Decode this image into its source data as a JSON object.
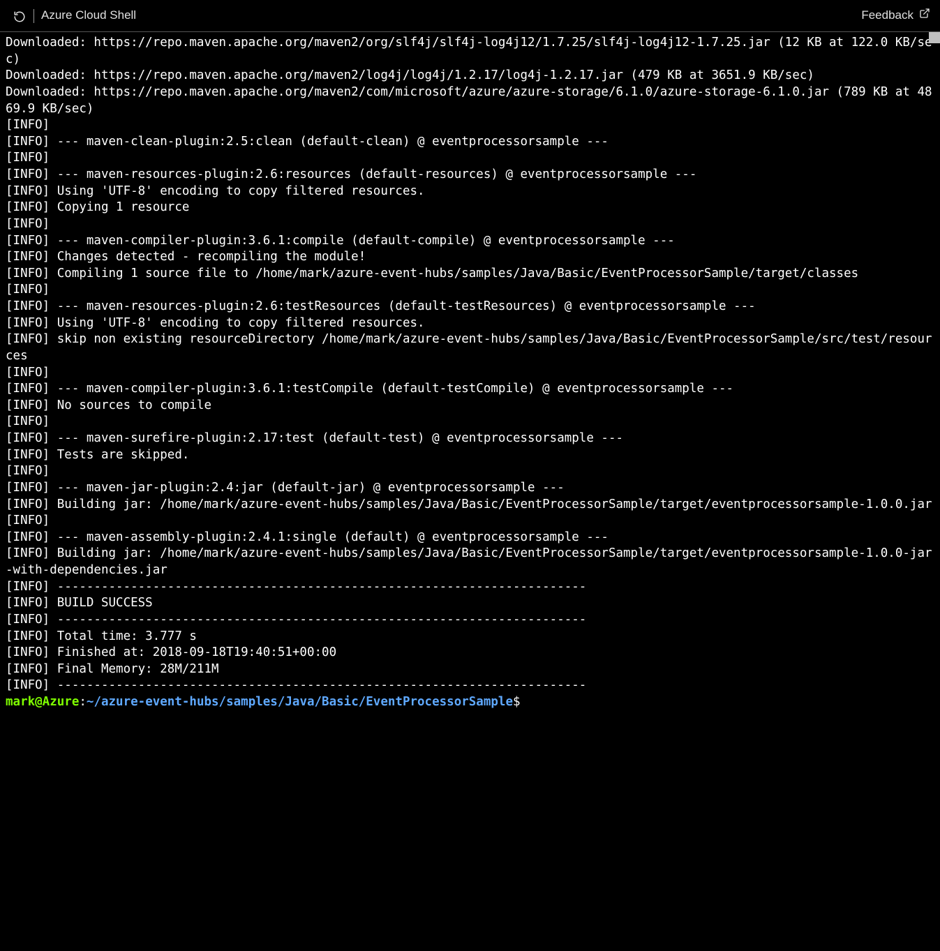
{
  "header": {
    "title": "Azure Cloud Shell",
    "feedback_label": "Feedback"
  },
  "terminal_output": "Downloaded: https://repo.maven.apache.org/maven2/org/slf4j/slf4j-log4j12/1.7.25/slf4j-log4j12-1.7.25.jar (12 KB at 122.0 KB/sec)\nDownloaded: https://repo.maven.apache.org/maven2/log4j/log4j/1.2.17/log4j-1.2.17.jar (479 KB at 3651.9 KB/sec)\nDownloaded: https://repo.maven.apache.org/maven2/com/microsoft/azure/azure-storage/6.1.0/azure-storage-6.1.0.jar (789 KB at 4869.9 KB/sec)\n[INFO]\n[INFO] --- maven-clean-plugin:2.5:clean (default-clean) @ eventprocessorsample ---\n[INFO]\n[INFO] --- maven-resources-plugin:2.6:resources (default-resources) @ eventprocessorsample ---\n[INFO] Using 'UTF-8' encoding to copy filtered resources.\n[INFO] Copying 1 resource\n[INFO]\n[INFO] --- maven-compiler-plugin:3.6.1:compile (default-compile) @ eventprocessorsample ---\n[INFO] Changes detected - recompiling the module!\n[INFO] Compiling 1 source file to /home/mark/azure-event-hubs/samples/Java/Basic/EventProcessorSample/target/classes\n[INFO]\n[INFO] --- maven-resources-plugin:2.6:testResources (default-testResources) @ eventprocessorsample ---\n[INFO] Using 'UTF-8' encoding to copy filtered resources.\n[INFO] skip non existing resourceDirectory /home/mark/azure-event-hubs/samples/Java/Basic/EventProcessorSample/src/test/resources\n[INFO]\n[INFO] --- maven-compiler-plugin:3.6.1:testCompile (default-testCompile) @ eventprocessorsample ---\n[INFO] No sources to compile\n[INFO]\n[INFO] --- maven-surefire-plugin:2.17:test (default-test) @ eventprocessorsample ---\n[INFO] Tests are skipped.\n[INFO]\n[INFO] --- maven-jar-plugin:2.4:jar (default-jar) @ eventprocessorsample ---\n[INFO] Building jar: /home/mark/azure-event-hubs/samples/Java/Basic/EventProcessorSample/target/eventprocessorsample-1.0.0.jar\n[INFO]\n[INFO] --- maven-assembly-plugin:2.4.1:single (default) @ eventprocessorsample ---\n[INFO] Building jar: /home/mark/azure-event-hubs/samples/Java/Basic/EventProcessorSample/target/eventprocessorsample-1.0.0-jar-with-dependencies.jar\n[INFO] ------------------------------------------------------------------------\n[INFO] BUILD SUCCESS\n[INFO] ------------------------------------------------------------------------\n[INFO] Total time: 3.777 s\n[INFO] Finished at: 2018-09-18T19:40:51+00:00\n[INFO] Final Memory: 28M/211M\n[INFO] ------------------------------------------------------------------------\n",
  "prompt": {
    "user_host": "mark@Azure",
    "colon": ":",
    "path": "~/azure-event-hubs/samples/Java/Basic/EventProcessorSample",
    "dollar": "$"
  }
}
